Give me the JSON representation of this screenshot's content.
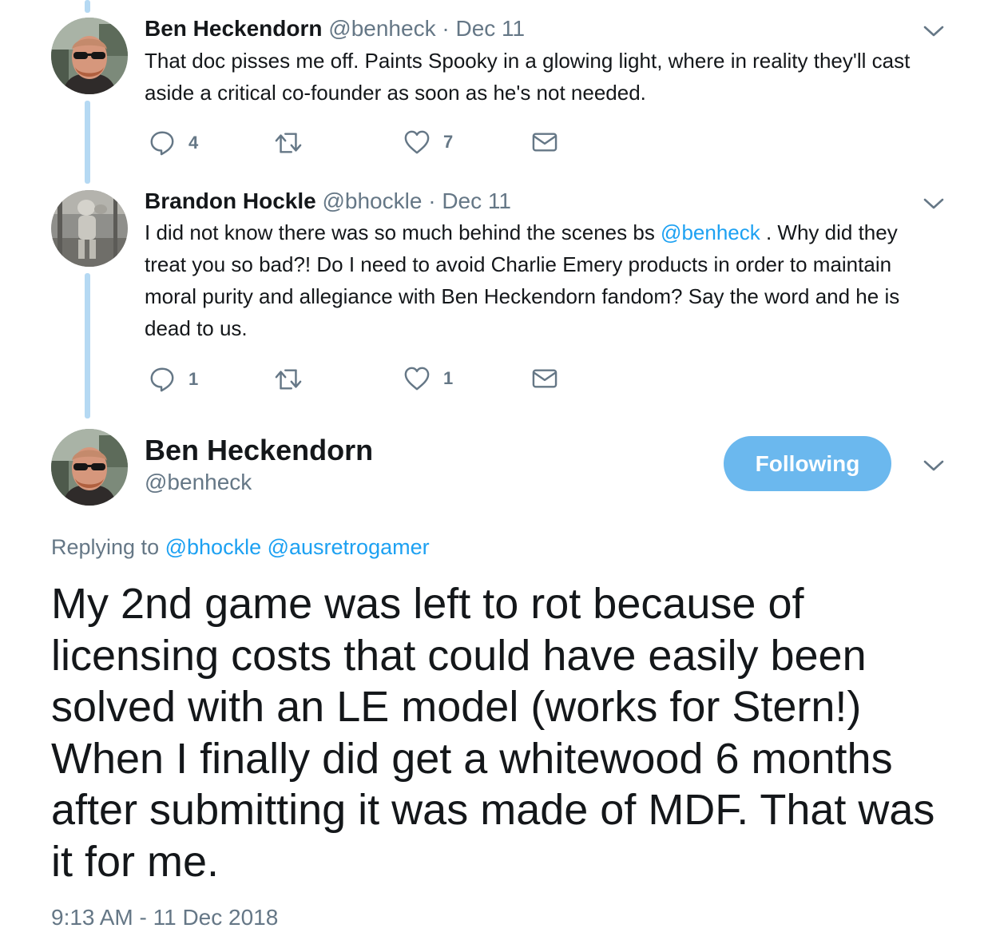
{
  "tweets": [
    {
      "name": "Ben Heckendorn",
      "handle": "@benheck",
      "separator": "·",
      "date": "Dec 11",
      "text": "That doc pisses me off. Paints Spooky in a glowing light, where in reality they'll cast aside a critical co-founder as soon as he's not needed.",
      "replies": "4",
      "likes": "7"
    },
    {
      "name": "Brandon Hockle",
      "handle": "@bhockle",
      "separator": "·",
      "date": "Dec 11",
      "text_before": "I did not know there was so much behind the scenes bs ",
      "mention": "@benheck",
      "text_after": " .  Why did they treat you so bad?! Do I need to avoid Charlie Emery products in order to maintain moral purity and allegiance with Ben Heckendorn fandom? Say the word and he is dead to us.",
      "replies": "1",
      "likes": "1"
    }
  ],
  "main": {
    "name": "Ben Heckendorn",
    "handle": "@benheck",
    "follow_label": "Following",
    "replying_prefix": "Replying to",
    "replying_mentions": [
      "@bhockle",
      "@ausretrogamer"
    ],
    "text": "My 2nd game was left to rot because of licensing costs that could have easily been solved with an LE model (works for Stern!) When I finally did get a whitewood 6 months after submitting it was made of MDF. That was it for me.",
    "timestamp": "9:13 AM - 11 Dec 2018"
  },
  "colors": {
    "accent": "#1da1f2",
    "following_button": "#6bb8ee",
    "thread_line": "#b5d9f3",
    "secondary_text": "#657786"
  },
  "icons": {
    "reply": "reply-icon",
    "retweet": "retweet-icon",
    "like": "heart-icon",
    "dm": "envelope-icon",
    "menu": "chevron-down-icon"
  }
}
